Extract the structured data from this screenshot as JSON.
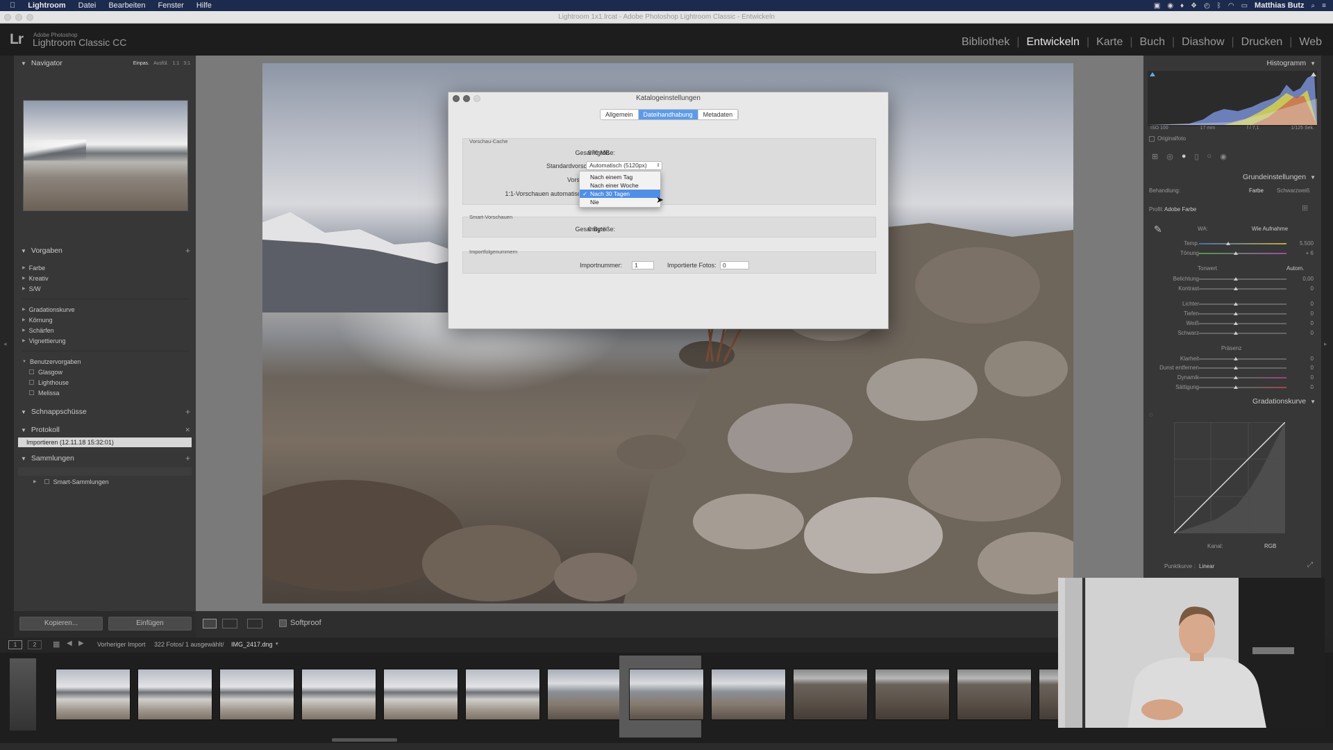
{
  "menubar": {
    "apple": "",
    "app": "Lightroom",
    "items": [
      "Datei",
      "Bearbeiten",
      "Fenster",
      "Hilfe"
    ],
    "user": "Matthias Butz"
  },
  "window": {
    "title": "Lightroom 1x1.lrcat - Adobe Photoshop Lightroom Classic - Entwickeln"
  },
  "lr": {
    "logo": "Lr",
    "sub": "Adobe Photoshop",
    "name": "Lightroom Classic CC",
    "modules": [
      "Bibliothek",
      "Entwickeln",
      "Karte",
      "Buch",
      "Diashow",
      "Drucken",
      "Web"
    ],
    "active_module": "Entwickeln"
  },
  "left": {
    "navigator": {
      "title": "Navigator",
      "opts": [
        "Einpas.",
        "Ausfül.",
        "1:1",
        "3:1"
      ]
    },
    "vorgaben": {
      "title": "Vorgaben",
      "items": [
        "Farbe",
        "Kreativ",
        "S/W",
        "Gradationskurve",
        "Körnung",
        "Schärfen",
        "Vignettierung"
      ],
      "user_group": "Benutzervorgaben",
      "user_items": [
        "Glasgow",
        "Lighthouse",
        "Melissa"
      ]
    },
    "schnappschuesse": "Schnappschüsse",
    "protokoll": {
      "title": "Protokoll",
      "entry": "Importieren (12.11.18 15:32:01)"
    },
    "sammlungen": {
      "title": "Sammlungen",
      "item": "Smart-Sammlungen"
    },
    "copy_button": "Kopieren...",
    "paste_button": "Einfügen"
  },
  "dialog": {
    "title": "Katalogeinstellungen",
    "tabs": [
      "Allgemein",
      "Dateihandhabung",
      "Metadaten"
    ],
    "selected_tab": "Dateihandhabung",
    "vorschau_cache": {
      "label": "Vorschau-Cache",
      "total_label": "Gesamtgröße:",
      "total_value": "970 MB",
      "std_label": "Standardvorschaugröße:",
      "std_value": "Automatisch (5120px)",
      "quality_label": "Vorschauqualität:",
      "discard_label": "1:1-Vorschauen automatisch verwerfen:"
    },
    "dropdown": {
      "options": [
        "Nach einem Tag",
        "Nach einer Woche",
        "Nach 30 Tagen",
        "Nie"
      ],
      "selected": "Nach 30 Tagen"
    },
    "smart": {
      "label": "Smart-Vorschauen",
      "total_label": "Gesamtgröße:",
      "total_value": "0 Byte"
    },
    "import": {
      "label": "Importfolgenummern",
      "num_label": "Importnummer:",
      "num_value": "1",
      "photos_label": "Importierte Fotos:",
      "photos_value": "0"
    }
  },
  "toolbar": {
    "softproof": "Softproof"
  },
  "filmstrip": {
    "screen1": "1",
    "screen2": "2",
    "source": "Vorheriger Import",
    "count": "322 Fotos/ 1 ausgewählt/",
    "filename": "IMG_2417.dng"
  },
  "right": {
    "histogram": {
      "title": "Histogramm",
      "iso": "ISO 100",
      "focal": "17 mm",
      "aperture": "f / 7,1",
      "shutter": "1/125 Sek.",
      "original": "Originalfoto"
    },
    "basic": {
      "title": "Grundeinstellungen",
      "treatment_label": "Behandlung:",
      "color": "Farbe",
      "bw": "Schwarzweiß",
      "profile_label": "Profil:",
      "profile": "Adobe Farbe",
      "wb_label": "WA:",
      "wb_value": "Wie Aufnahme",
      "temp_label": "Temp.",
      "temp_value": "5.500",
      "tint_label": "Tönung",
      "tint_value": "+ 6",
      "tone_label": "Tonwert",
      "auto": "Autom.",
      "tone_sliders": [
        {
          "label": "Belichtung",
          "value": "0,00"
        },
        {
          "label": "Kontrast",
          "value": "0"
        },
        {
          "label": "Lichter",
          "value": "0"
        },
        {
          "label": "Tiefen",
          "value": "0"
        },
        {
          "label": "Weiß",
          "value": "0"
        },
        {
          "label": "Schwarz",
          "value": "0"
        }
      ],
      "presence_label": "Präsenz",
      "presence_sliders": [
        {
          "label": "Klarheit",
          "value": "0"
        },
        {
          "label": "Dunst entfernen",
          "value": "0"
        },
        {
          "label": "Dynamik",
          "value": "0"
        },
        {
          "label": "Sättigung",
          "value": "0"
        }
      ]
    },
    "curve": {
      "title": "Gradationskurve",
      "channel_label": "Kanal:",
      "channel": "RGB",
      "point_label": "Punktkurve :",
      "point": "Linear"
    }
  },
  "colors": {
    "accent": "#5d9be8",
    "menubar": "#1c2a4e",
    "panel": "#373737"
  }
}
